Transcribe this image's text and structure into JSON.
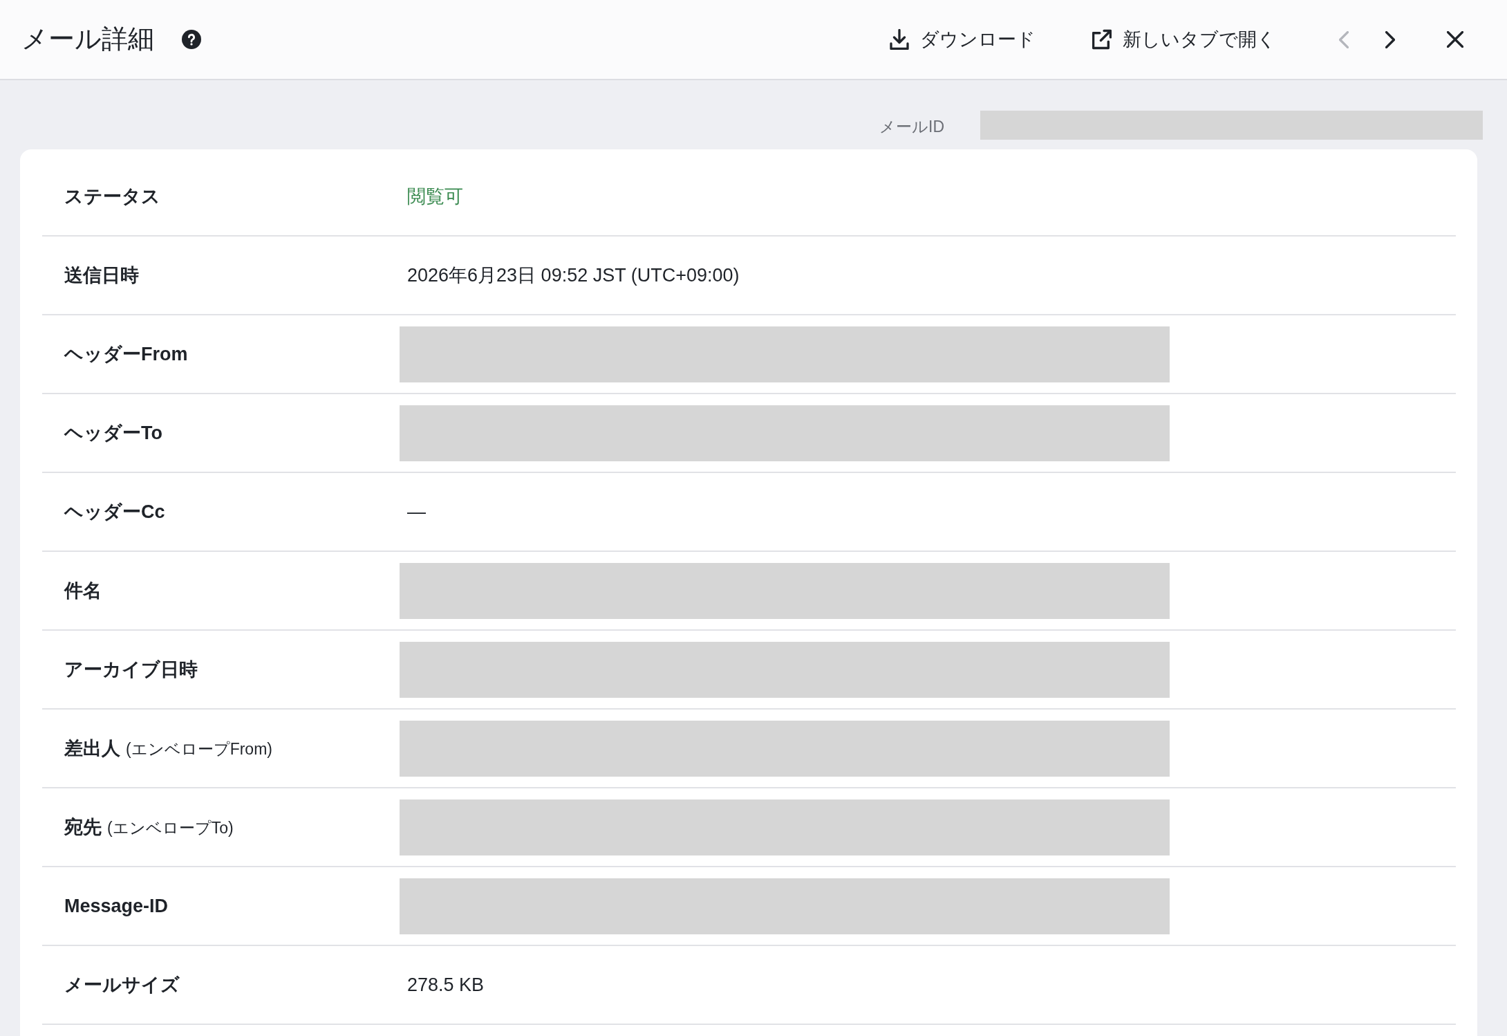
{
  "header": {
    "title": "メール詳細",
    "actions": [
      {
        "kind": "download",
        "label": "ダウンロード"
      },
      {
        "kind": "open_new_tab",
        "label": "新しいタブで開く"
      }
    ],
    "navigation": {
      "previous": {
        "disabled": true
      },
      "next": {
        "disabled": false
      }
    }
  },
  "mail_id": {
    "label": "メールID",
    "redacted": true
  },
  "rows": [
    {
      "label": "ステータス",
      "kind": "status",
      "value": "閲覧可",
      "color": "#3a8a50"
    },
    {
      "label": "送信日時",
      "kind": "text",
      "value": "2026年6月23日 09:52 JST (UTC+09:00)"
    },
    {
      "label": "ヘッダーFrom",
      "kind": "redacted"
    },
    {
      "label": "ヘッダーTo",
      "kind": "redacted"
    },
    {
      "label": "ヘッダーCc",
      "kind": "text",
      "value": "—"
    },
    {
      "label": "件名",
      "kind": "redacted"
    },
    {
      "label": "アーカイブ日時",
      "kind": "redacted"
    },
    {
      "label": "差出人",
      "label_note": "(エンベロープFrom)",
      "kind": "redacted"
    },
    {
      "label": "宛先",
      "label_note": "(エンベロープTo)",
      "kind": "redacted"
    },
    {
      "label": "Message-ID",
      "kind": "redacted"
    },
    {
      "label": "メールサイズ",
      "kind": "text",
      "value": "278.5 KB"
    }
  ]
}
